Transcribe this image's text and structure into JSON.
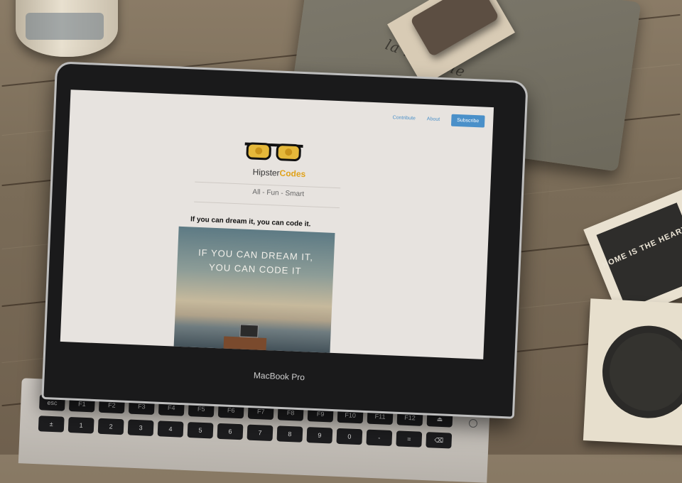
{
  "scene": {
    "pouch_text": "la libellule",
    "coaster_text": "HOME IS THE HEART OF THE HOLIDAYS",
    "laptop_brand": "MacBook Pro"
  },
  "website": {
    "nav": {
      "contribute": "Contribute",
      "about": "About",
      "subscribe": "Subscribe"
    },
    "logo": {
      "part1": "Hipster",
      "part2": "Codes"
    },
    "tagline": "All - Fun - Smart",
    "post": {
      "title": "If you can dream it, you can code it.",
      "image_caption_line1": "IF YOU CAN DREAM IT,",
      "image_caption_line2": "YOU CAN CODE IT"
    }
  },
  "keyboard": {
    "row1": [
      "esc",
      "F1",
      "F2",
      "F3",
      "F4",
      "F5",
      "F6",
      "F7",
      "F8",
      "F9",
      "F10",
      "F11",
      "F12",
      "⏏"
    ],
    "row2": [
      "±",
      "1",
      "2",
      "3",
      "4",
      "5",
      "6",
      "7",
      "8",
      "9",
      "0",
      "-",
      "=",
      "⌫"
    ]
  },
  "colors": {
    "accent": "#e0a21a",
    "link": "#4a90c9",
    "screen_bg": "#e7e3df"
  }
}
